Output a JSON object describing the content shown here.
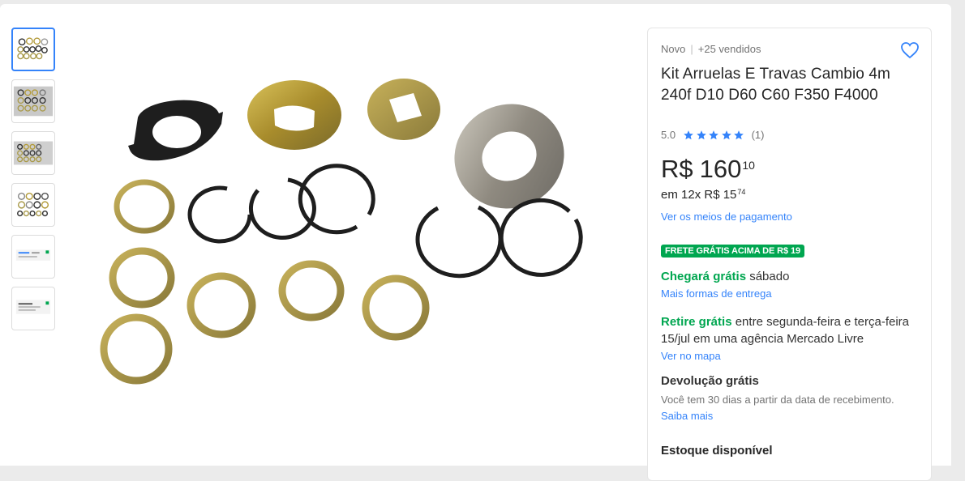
{
  "product": {
    "condition": "Novo",
    "sold": "+25 vendidos",
    "title": "Kit Arruelas E Travas Cambio 4m 240f D10 D60 C60 F350 F4000",
    "rating": {
      "score": "5.0",
      "stars": 5,
      "count": "(1)"
    },
    "price": {
      "currency": "R$",
      "integer": "160",
      "cents": "10"
    },
    "installments": {
      "text": "em 12x R$ 15",
      "cents": "74"
    },
    "payment_link": "Ver os meios de pagamento"
  },
  "shipping": {
    "badge": "FRETE GRÁTIS ACIMA DE R$ 19",
    "arrival_highlight": "Chegará grátis",
    "arrival_day": "sábado",
    "delivery_link": "Mais formas de entrega",
    "pickup_highlight": "Retire grátis",
    "pickup_text": "entre segunda-feira e terça-feira 15/jul em uma agência Mercado Livre",
    "map_link": "Ver no mapa"
  },
  "returns": {
    "title": "Devolução grátis",
    "note": "Você tem 30 dias a partir da data de recebimento.",
    "more_link": "Saiba mais"
  },
  "stock": {
    "label": "Estoque disponível"
  },
  "gallery": {
    "thumbnail_count": 6,
    "selected": 0
  },
  "colors": {
    "accent": "#3483fa",
    "green": "#00a650",
    "stars": "#3483fa"
  }
}
